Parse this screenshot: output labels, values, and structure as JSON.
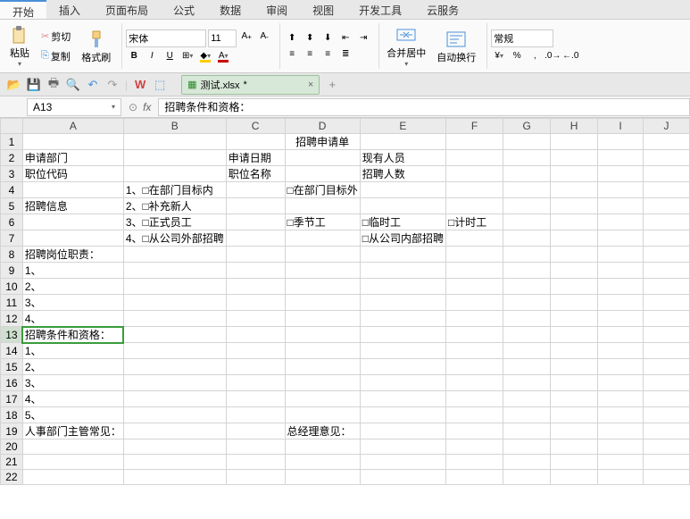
{
  "tabs": [
    "开始",
    "插入",
    "页面布局",
    "公式",
    "数据",
    "审阅",
    "视图",
    "开发工具",
    "云服务"
  ],
  "active_tab": 0,
  "clipboard": {
    "paste": "粘贴",
    "cut": "剪切",
    "copy": "复制",
    "format_painter": "格式刷"
  },
  "font": {
    "name": "宋体",
    "size": "11",
    "bold": "B",
    "italic": "I",
    "underline": "U"
  },
  "merge": "合并居中",
  "wrap": "自动换行",
  "number_format": "常规",
  "doc": {
    "name": "测试.xlsx",
    "modified": "*"
  },
  "namebox": "A13",
  "fx_label": "fx",
  "formula": "招聘条件和资格：",
  "columns": [
    "A",
    "B",
    "C",
    "D",
    "E",
    "F",
    "G",
    "H",
    "I",
    "J"
  ],
  "rows": 22,
  "cells": {
    "1": {
      "D": "招聘申请单"
    },
    "2": {
      "A": "申请部门",
      "C": "申请日期",
      "E": "现有人员"
    },
    "3": {
      "A": "职位代码",
      "C": "职位名称",
      "E": "招聘人数"
    },
    "4": {
      "B": "1、□在部门目标内",
      "D": "□在部门目标外"
    },
    "5": {
      "A": "招聘信息",
      "B": "2、□补充新人"
    },
    "6": {
      "B": "3、□正式员工",
      "D": "□季节工",
      "E": "□临时工",
      "F": "□计时工"
    },
    "7": {
      "B": "4、□从公司外部招聘",
      "E": "□从公司内部招聘"
    },
    "8": {
      "A": "招聘岗位职责："
    },
    "9": {
      "A": "1、"
    },
    "10": {
      "A": "2、"
    },
    "11": {
      "A": "3、"
    },
    "12": {
      "A": "4、"
    },
    "13": {
      "A": "招聘条件和资格："
    },
    "14": {
      "A": "1、"
    },
    "15": {
      "A": "2、"
    },
    "16": {
      "A": "3、"
    },
    "17": {
      "A": "4、"
    },
    "18": {
      "A": "5、"
    },
    "19": {
      "A": "人事部门主管常见：",
      "D": "总经理意见："
    }
  },
  "selected_cell": {
    "row": 13,
    "col": "A"
  }
}
